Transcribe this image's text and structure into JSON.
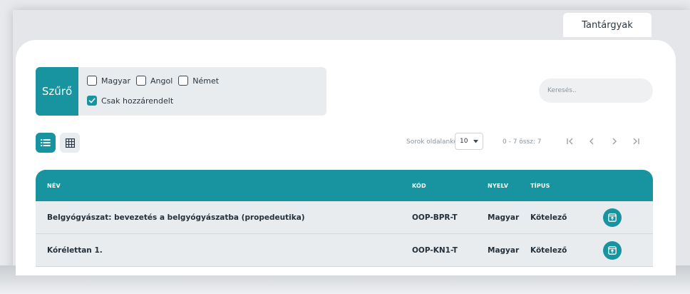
{
  "colors": {
    "accent": "#17949f",
    "panel": "#e9ecef",
    "text": "#24303a",
    "muted": "#8a939b"
  },
  "tab": {
    "label": "Tantárgyak"
  },
  "filter": {
    "label": "Szűrő",
    "languages": [
      {
        "label": "Magyar",
        "checked": false
      },
      {
        "label": "Angol",
        "checked": false
      },
      {
        "label": "Német",
        "checked": false
      }
    ],
    "assigned_only": {
      "label": "Csak hozzárendelt",
      "checked": true
    }
  },
  "search": {
    "placeholder": "Keresés..",
    "value": ""
  },
  "view": {
    "modes": [
      "list-icon",
      "grid-icon"
    ],
    "active": "list"
  },
  "pagination": {
    "rows_per_page_label": "Sorok oldalanként:",
    "rows_per_page_value": "10",
    "range_text": "0 - 7 össz: 7"
  },
  "table": {
    "columns": {
      "name": "NÉV",
      "code": "KÓD",
      "language": "NYELV",
      "type": "TÍPUS"
    },
    "rows": [
      {
        "name": "Belgyógyászat: bevezetés a belgyógyászatba (propedeutika)",
        "code": "OOP-BPR-T",
        "language": "Magyar",
        "type": "Kötelező"
      },
      {
        "name": "Kórélettan 1.",
        "code": "OOP-KN1-T",
        "language": "Magyar",
        "type": "Kötelező"
      }
    ]
  }
}
